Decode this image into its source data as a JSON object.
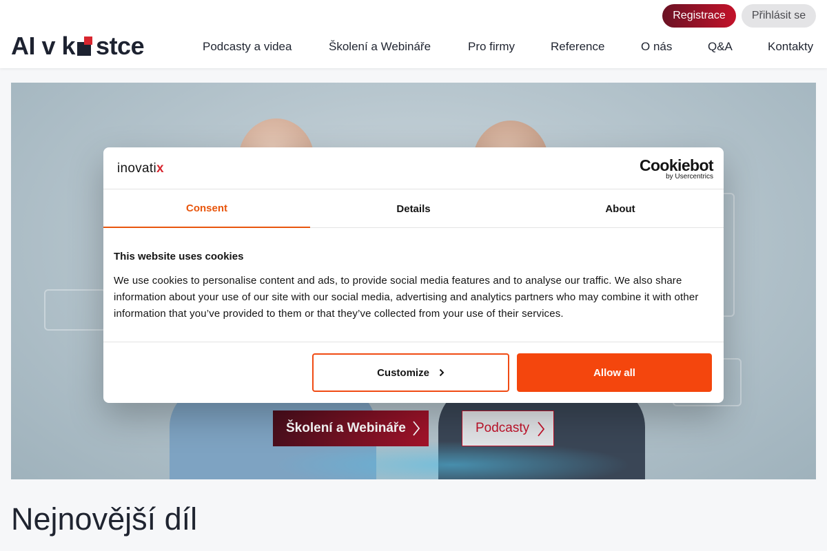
{
  "header": {
    "logo": {
      "part1": "AI v k",
      "part2": "stce"
    },
    "register_label": "Registrace",
    "login_label": "Přihlásit se",
    "nav": [
      {
        "label": "Podcasty a videa"
      },
      {
        "label": "Školení a Webináře"
      },
      {
        "label": "Pro firmy"
      },
      {
        "label": "Reference"
      },
      {
        "label": "O nás"
      },
      {
        "label": "Q&A"
      },
      {
        "label": "Kontakty"
      }
    ]
  },
  "hero": {
    "primary_button": "Školení a Webináře",
    "secondary_button": "Podcasty"
  },
  "section": {
    "title": "Nejnovější díl"
  },
  "cookie_dialog": {
    "brand": "inovati",
    "brand_mark": "x",
    "provider": "Cookiebot",
    "provider_sub": "by Usercentrics",
    "tabs": [
      {
        "label": "Consent",
        "active": true
      },
      {
        "label": "Details",
        "active": false
      },
      {
        "label": "About",
        "active": false
      }
    ],
    "title": "This website uses cookies",
    "text": "We use cookies to personalise content and ads, to provide social media features and to analyse our traffic. We also share information about your use of our site with our social media, advertising and analytics partners who may combine it with other information that you’ve provided to them or that they’ve collected from your use of their services.",
    "customize_label": "Customize",
    "allow_label": "Allow all"
  },
  "colors": {
    "accent_red": "#c3122a",
    "cookie_orange": "#f4460d",
    "dark_text": "#1f2430"
  }
}
